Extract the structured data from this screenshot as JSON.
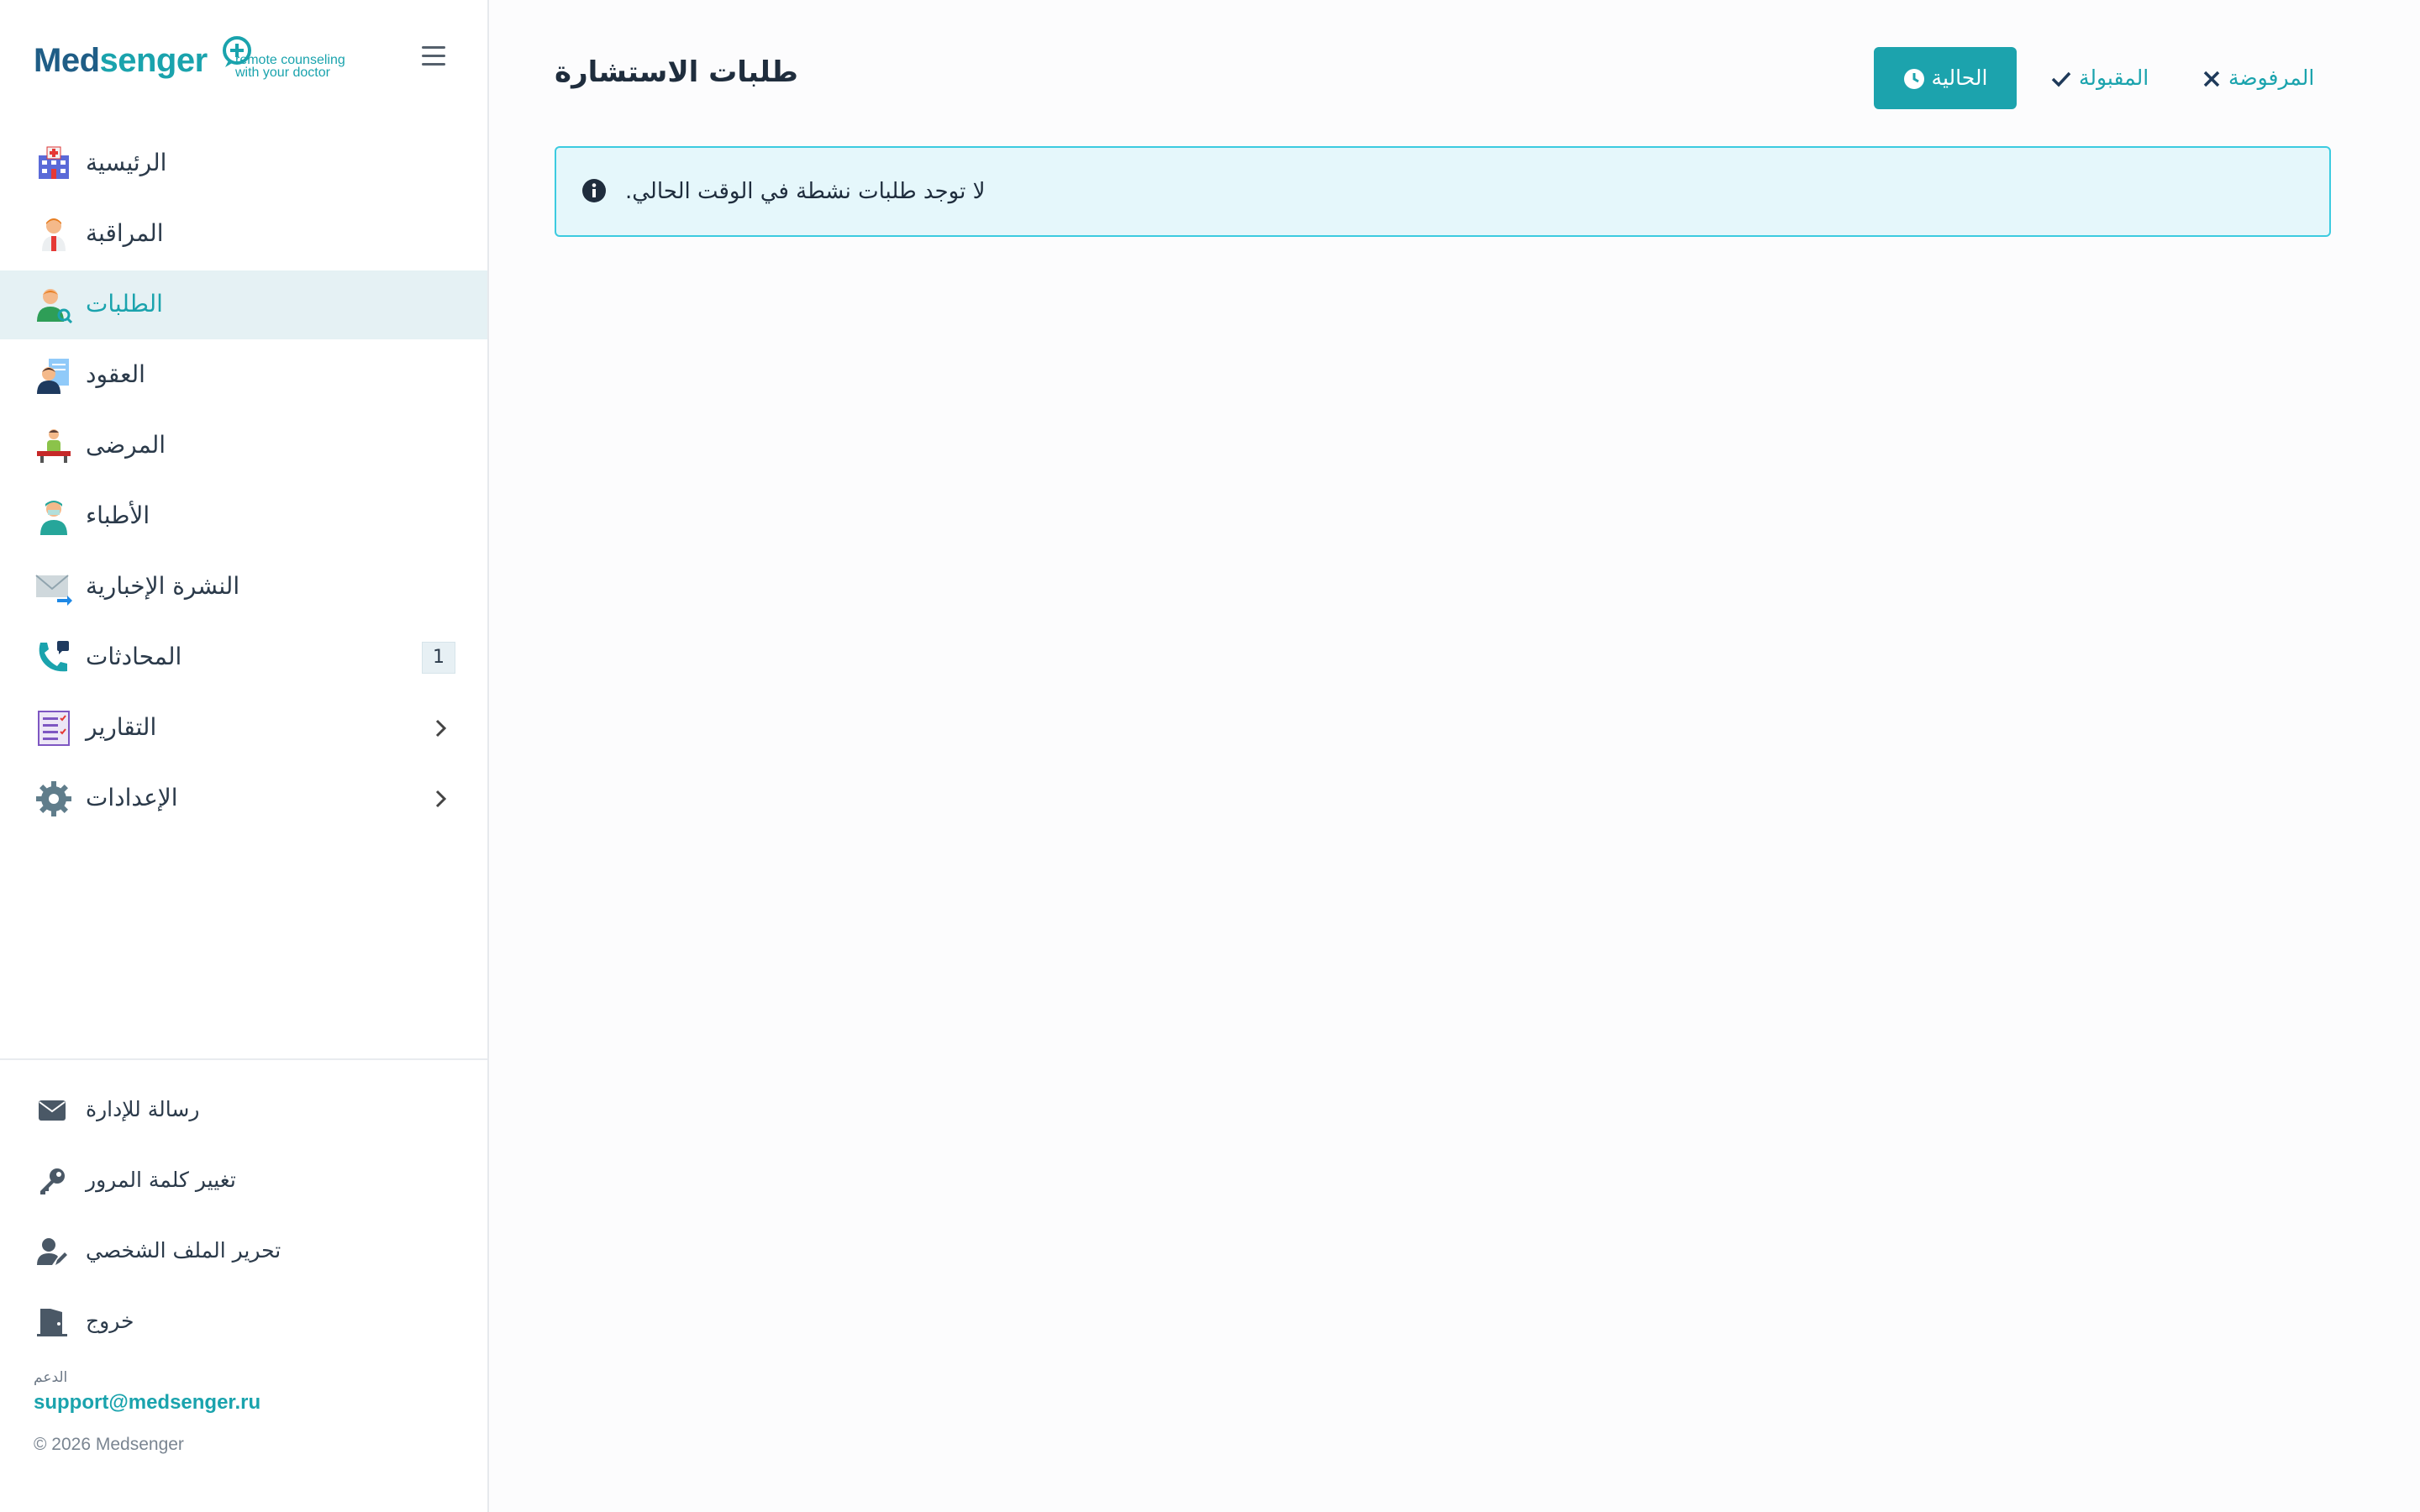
{
  "brand": {
    "name_part1": "Med",
    "name_part2": "senger",
    "tagline_line1": "remote counseling",
    "tagline_line2": "with your doctor",
    "accent_color": "#1aa3ad",
    "dark_color": "#1f5d86"
  },
  "sidebar": {
    "items": [
      {
        "label": "الرئيسية",
        "icon": "hospital-icon"
      },
      {
        "label": "المراقبة",
        "icon": "doctor-icon"
      },
      {
        "label": "الطلبات",
        "icon": "requests-icon",
        "active": true
      },
      {
        "label": "العقود",
        "icon": "contracts-icon"
      },
      {
        "label": "المرضى",
        "icon": "patients-icon"
      },
      {
        "label": "الأطباء",
        "icon": "doctors-icon"
      },
      {
        "label": "النشرة الإخبارية",
        "icon": "newsletter-icon"
      },
      {
        "label": "المحادثات",
        "icon": "phone-icon",
        "badge": "1"
      },
      {
        "label": "التقارير",
        "icon": "reports-icon"
      },
      {
        "label": "الإعدادات",
        "icon": "gear-icon"
      }
    ],
    "bottom_items": [
      {
        "label": "رسالة للإدارة",
        "icon": "envelope-icon"
      },
      {
        "label": "تغيير كلمة المرور",
        "icon": "key-icon"
      },
      {
        "label": "تحرير الملف الشخصي",
        "icon": "user-edit-icon"
      },
      {
        "label": "خروج",
        "icon": "door-icon"
      }
    ],
    "support_title": "الدعم",
    "support_email": "support@medsenger.ru",
    "copyright": "© 2026 Medsenger"
  },
  "main": {
    "title": "طلبات الاستشارة",
    "filters": {
      "current": "الحالية",
      "accepted": "المقبولة",
      "rejected": "المرفوضة"
    },
    "alert_text": ".لا توجد طلبات نشطة في الوقت الحالي"
  }
}
